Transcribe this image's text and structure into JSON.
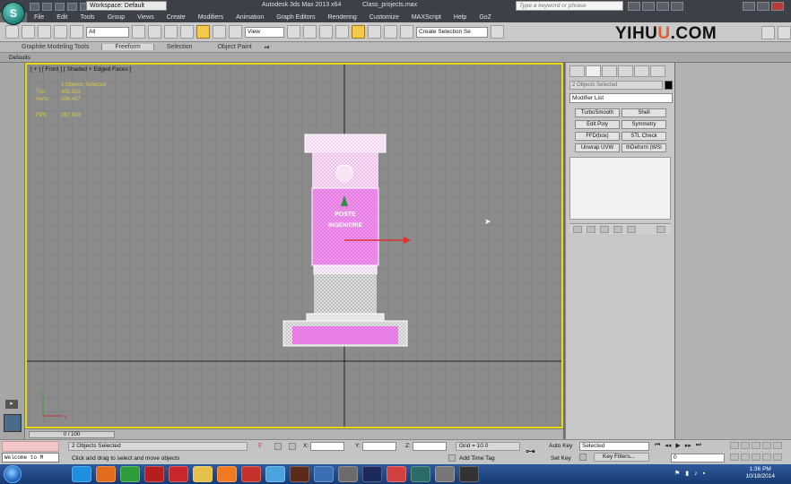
{
  "titlebar": {
    "logo_text": "S",
    "workspace": "Workspace: Default",
    "app_title": "Autodesk 3ds Max  2013 x64",
    "file_name": "Class_projects.max",
    "search_placeholder": "Type a keyword or phrase"
  },
  "menu": [
    "File",
    "Edit",
    "Tools",
    "Group",
    "Views",
    "Create",
    "Modifiers",
    "Animation",
    "Graph Editors",
    "Rendering",
    "Customize",
    "MAXScript",
    "Help",
    "GoZ"
  ],
  "toolbar": {
    "selection_filter": "All",
    "ref_coord": "View",
    "named_selection": "Create Selection Se"
  },
  "watermark": {
    "part1": "YIHU",
    "part2": "U",
    "part3": ".COM"
  },
  "ribbon": {
    "tabs": [
      "Graphite Modeling Tools",
      "Freeform",
      "Selection",
      "Object Paint"
    ],
    "active_tab": "Freeform",
    "defaults_label": "Defaults"
  },
  "viewport": {
    "label": "[ + ] [ Front ] [ Shaded + Edged Faces ]",
    "stats_title": "2 Objects Selected",
    "tris_label": "Tris:",
    "tris_value": "400,582",
    "verts_label": "Verts:",
    "verts_value": "206,457",
    "fps_label": "FPS:",
    "fps_value": "287.943",
    "object_text1": "POSTE",
    "object_text2": "INGENIERIE",
    "axis_x": "x",
    "axis_y": "y"
  },
  "command_panel": {
    "selection": "2 Objects Selected",
    "modifier_list": "Modifier List",
    "modifier_buttons": [
      [
        "TurboSmooth",
        "Shell"
      ],
      [
        "Edit Poly",
        "Symmetry"
      ],
      [
        "FFD(box)",
        "STL Check"
      ],
      [
        "Unwrap UVW",
        "thDeform (WSI"
      ]
    ]
  },
  "trackbar": {
    "frame": "0 / 100"
  },
  "status": {
    "maxscript": "Welcome to M",
    "objects_selected": "2 Objects Selected",
    "prompt": "Click and drag to select and move objects",
    "x_label": "X:",
    "y_label": "Y:",
    "z_label": "Z:",
    "grid": "Grid = 10.0",
    "add_time_tag": "Add Time Tag",
    "auto_key": "Auto Key",
    "set_key": "Set Key",
    "key_mode": "Selected",
    "key_filters": "Key Filters...",
    "frame_field": "0"
  },
  "taskbar": {
    "time": "1:36 PM",
    "date": "10/18/2014",
    "icons": [
      "ie-icon",
      "firefox-icon",
      "chrome-icon",
      "filezilla-icon",
      "opera-icon",
      "folder-icon",
      "media-player-icon",
      "paint-icon",
      "dropbox-icon",
      "app-icon",
      "screen-icon",
      "person-icon",
      "photoshop-icon",
      "snagit-icon",
      "max-icon",
      "unknown-icon",
      "unity-icon"
    ],
    "icon_colors": [
      "#1f8fe0",
      "#e36b1c",
      "#2e9c3a",
      "#b51e1e",
      "#c8272b",
      "#e6c04a",
      "#f07a22",
      "#c4302b",
      "#4aa3df",
      "#5b2a1a",
      "#3a6fb3",
      "#6c6c6c",
      "#1b2a5a",
      "#d24040",
      "#2b6c66",
      "#777777",
      "#333333"
    ]
  },
  "colors": {
    "viewport_border": "#e5d91a",
    "object_pink": "#e77ee6",
    "stats_text": "#d8c848",
    "active_tool": "#f2c94a"
  }
}
